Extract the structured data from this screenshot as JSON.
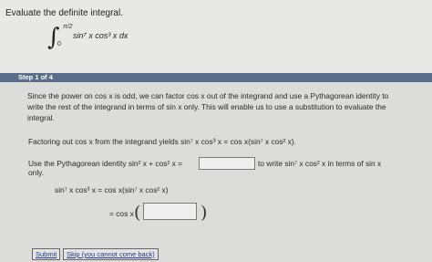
{
  "question": {
    "prompt": "Evaluate the definite integral.",
    "integral": {
      "upper_limit": "π/2",
      "lower_limit": "0",
      "integrand": "sin⁷ x cos³ x dx"
    }
  },
  "step": {
    "label": "Step 1 of 4",
    "intro_lines": [
      "Since the power on  cos x  is odd, we can factor  cos x  out of the integrand and use a Pythagorean identity to",
      "write the rest of the integrand in terms of  sin x  only. This will enable us to use a substitution to evaluate the",
      "integral."
    ],
    "factor_line": "Factoring out  cos x  from the integrand yields  sin⁷ x cos³ x = cos x(sin⁷ x cos² x).",
    "use_line_left": "Use the Pythagorean identity  sin² x + cos² x =",
    "use_line_right": "to write  sin⁷ x cos² x  in terms of  sin x",
    "use_line_only": "only.",
    "equation_line1": "sin⁷ x cos³ x  =  cos x(sin⁷ x cos² x)",
    "equation_line2_left": "= cos x",
    "answer_inputs": {
      "identity_value": "",
      "rewrite_value": ""
    }
  },
  "buttons": {
    "submit": "Submit",
    "skip": "Skip (you cannot come back)"
  }
}
